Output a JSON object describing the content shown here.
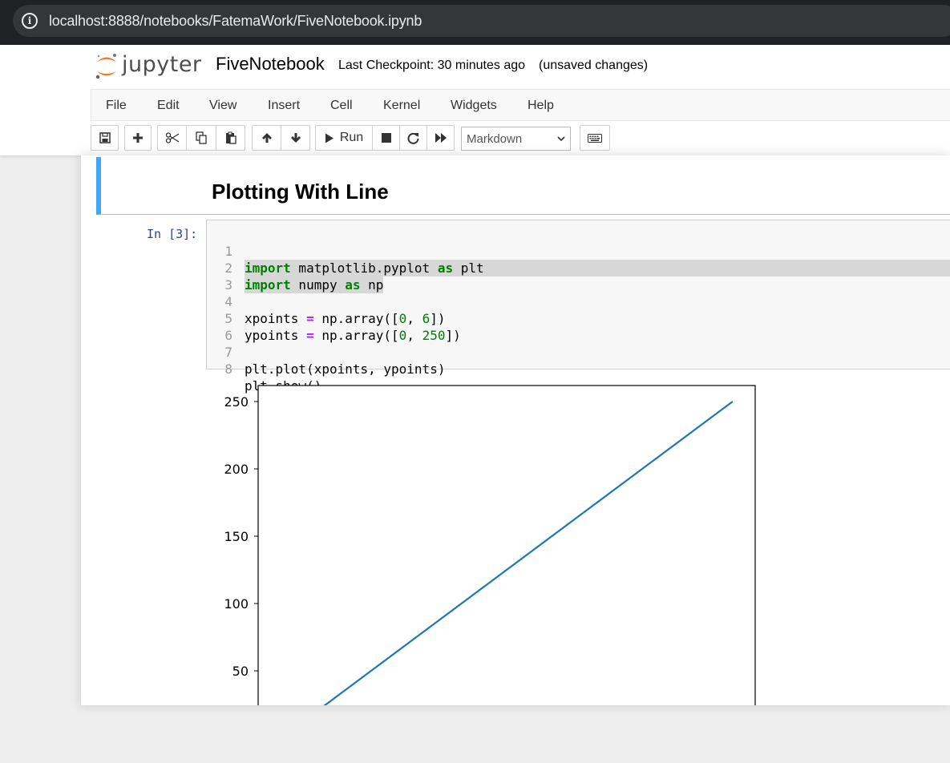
{
  "browser": {
    "url": "localhost:8888/notebooks/FatemaWork/FiveNotebook.ipynb",
    "info_icon": "i"
  },
  "header": {
    "logo_text": "jupyter",
    "notebook_name": "FiveNotebook",
    "checkpoint": "Last Checkpoint: 30 minutes ago",
    "status": "(unsaved changes)"
  },
  "menu": [
    "File",
    "Edit",
    "View",
    "Insert",
    "Cell",
    "Kernel",
    "Widgets",
    "Help"
  ],
  "toolbar": {
    "run_label": "Run",
    "cell_type": "Markdown"
  },
  "markdown_cell": {
    "heading": "Plotting With Line"
  },
  "code_cell": {
    "prompt": "In [3]:",
    "line_numbers": [
      "1",
      "2",
      "3",
      "4",
      "5",
      "6",
      "7",
      "8"
    ],
    "lines": [
      "import matplotlib.pyplot as plt",
      "import numpy as np",
      "",
      "xpoints = np.array([0, 6])",
      "ypoints = np.array([0, 250])",
      "",
      "plt.plot(xpoints, ypoints)",
      "plt.show()"
    ]
  },
  "chart_data": {
    "type": "line",
    "series": [
      {
        "x": [
          0,
          6
        ],
        "y": [
          0,
          250
        ],
        "color": "#1f77b4"
      }
    ],
    "yticks": [
      50,
      100,
      150,
      200,
      250
    ],
    "xlim": [
      -0.3,
      6.3
    ],
    "ylim": [
      -12.5,
      262.5
    ],
    "grid": false
  }
}
